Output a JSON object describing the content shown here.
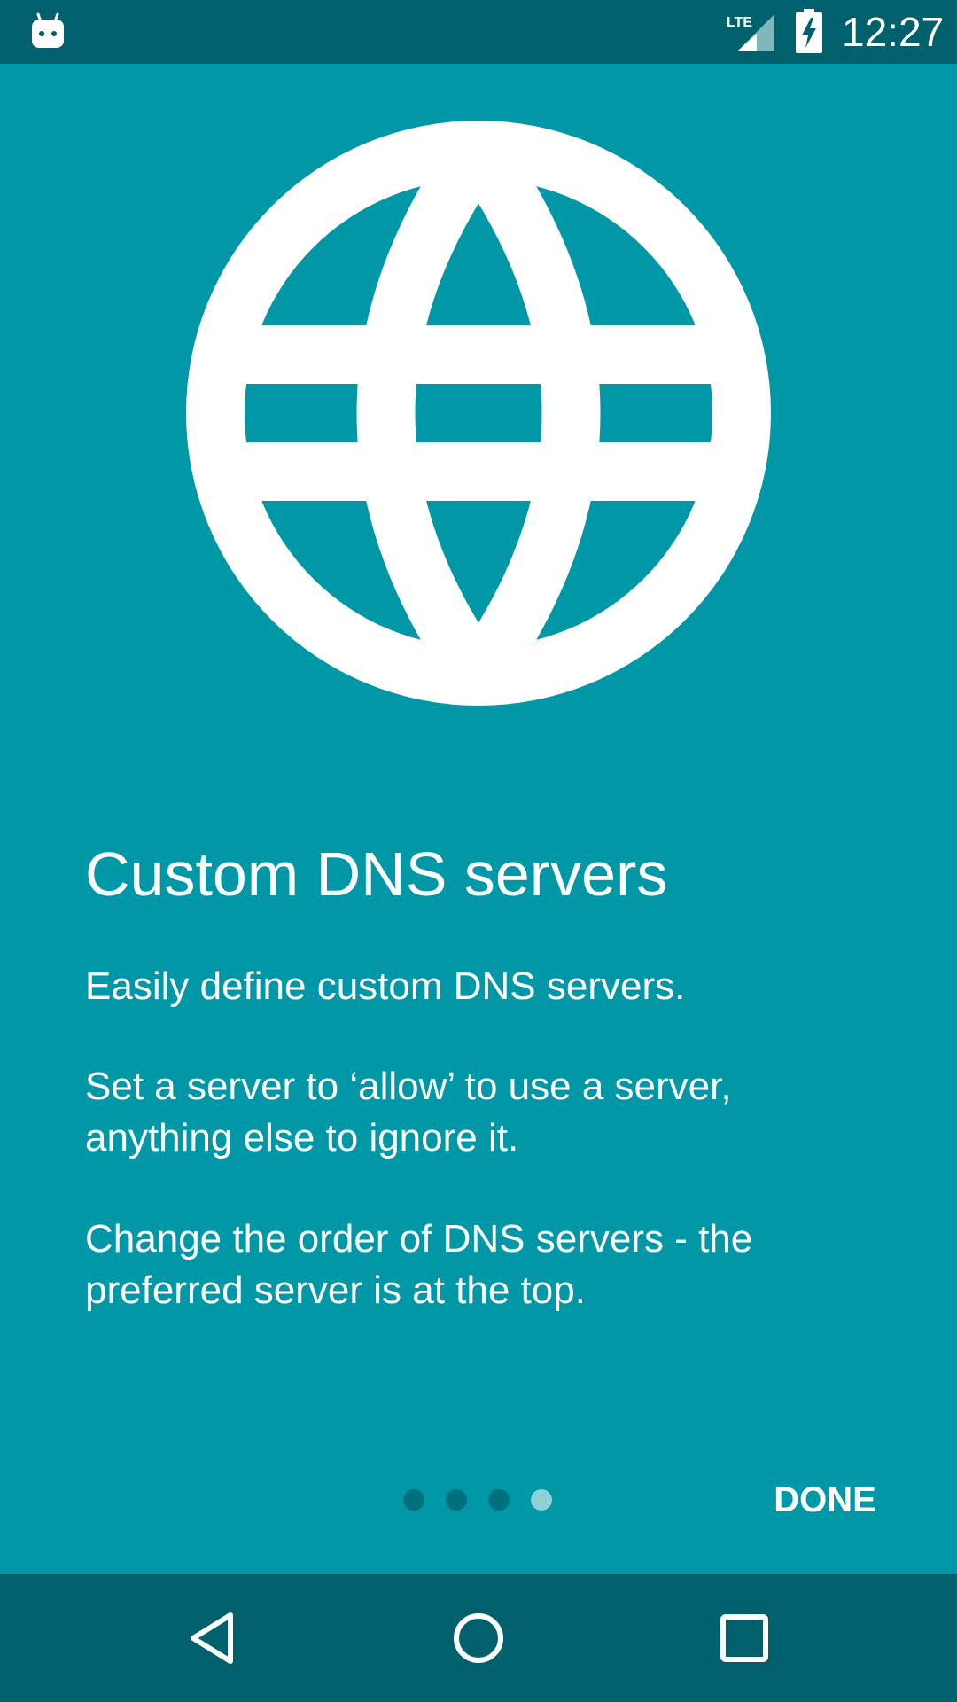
{
  "status_bar": {
    "time": "12:27",
    "notification_icon": "android-head-icon",
    "network_label": "LTE",
    "signal_icon": "signal-icon",
    "battery_icon": "battery-charging-icon"
  },
  "intro": {
    "hero_icon": "globe-icon",
    "title": "Custom DNS servers",
    "paragraphs": [
      "Easily define custom DNS servers.",
      "Set a server to ‘allow’ to use a server, anything else to ignore it.",
      "Change the order of DNS servers - the preferred server is at the top."
    ]
  },
  "pager": {
    "total_pages": 4,
    "current_page": 4
  },
  "actions": {
    "done_label": "DONE"
  },
  "nav_bar": {
    "back_icon": "back-icon",
    "home_icon": "home-icon",
    "recents_icon": "recents-icon"
  },
  "colors": {
    "background": "#0097a7",
    "bars": "#00606b",
    "dot_inactive": "#00707c",
    "dot_active": "#8fd1d8",
    "foreground": "#ffffff"
  }
}
